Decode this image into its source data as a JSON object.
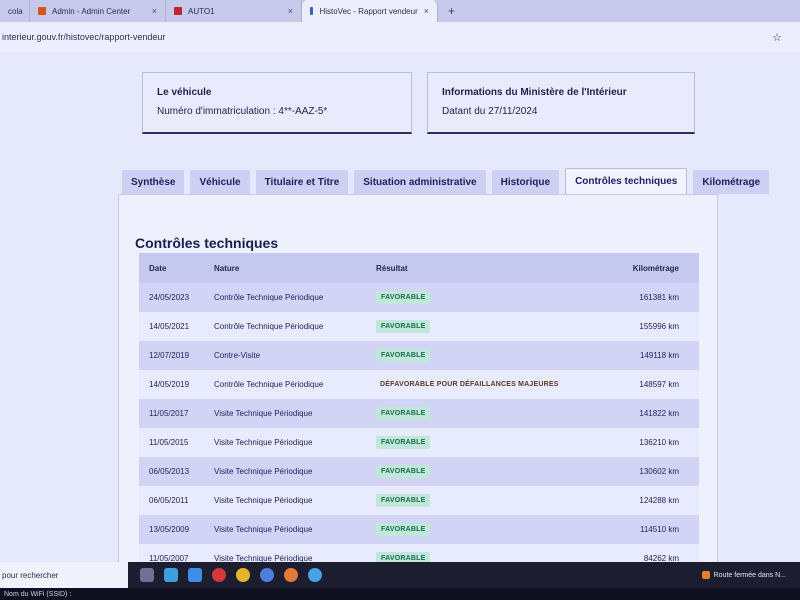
{
  "browser": {
    "tabs": [
      {
        "label": "cola",
        "favicon_color": "#5a6cc2"
      },
      {
        "label": "Admin - Admin Center",
        "favicon_color": "#d9531e"
      },
      {
        "label": "AUTO1",
        "favicon_color": "#c0262d"
      },
      {
        "label": "HistoVec - Rapport vendeur",
        "favicon_color": "#3b5fc9"
      }
    ],
    "new_tab_label": "+",
    "close_label": "×",
    "url": "interieur.gouv.fr/histovec/rapport-vendeur",
    "star_label": "☆"
  },
  "vehicle": {
    "title": "Le véhicule",
    "value": "Numéro d'immatriculation : 4**-AAZ-5*"
  },
  "ministry": {
    "title": "Informations du Ministère de l'Intérieur",
    "value": "Datant du 27/11/2024"
  },
  "tabs": [
    {
      "label": "Synthèse"
    },
    {
      "label": "Véhicule"
    },
    {
      "label": "Titulaire et Titre"
    },
    {
      "label": "Situation administrative"
    },
    {
      "label": "Historique"
    },
    {
      "label": "Contrôles techniques",
      "active": true
    },
    {
      "label": "Kilométrage"
    }
  ],
  "controls": {
    "title": "Contrôles techniques",
    "headers": {
      "date": "Date",
      "nature": "Nature",
      "result": "Résultat",
      "km": "Kilométrage"
    },
    "rows": [
      {
        "date": "24/05/2023",
        "nature": "Contrôle Technique Périodique",
        "result": "FAVORABLE",
        "km": "161381 km"
      },
      {
        "date": "14/05/2021",
        "nature": "Contrôle Technique Périodique",
        "result": "FAVORABLE",
        "km": "155996 km"
      },
      {
        "date": "12/07/2019",
        "nature": "Contre-Visite",
        "result": "FAVORABLE",
        "km": "149118 km"
      },
      {
        "date": "14/05/2019",
        "nature": "Contrôle Technique Périodique",
        "result": "DÉFAVORABLE POUR DÉFAILLANCES MAJEURES",
        "km": "148597 km"
      },
      {
        "date": "11/05/2017",
        "nature": "Visite Technique Périodique",
        "result": "FAVORABLE",
        "km": "141822 km"
      },
      {
        "date": "11/05/2015",
        "nature": "Visite Technique Périodique",
        "result": "FAVORABLE",
        "km": "136210 km"
      },
      {
        "date": "06/05/2013",
        "nature": "Visite Technique Périodique",
        "result": "FAVORABLE",
        "km": "130602 km"
      },
      {
        "date": "06/05/2011",
        "nature": "Visite Technique Périodique",
        "result": "FAVORABLE",
        "km": "124288 km"
      },
      {
        "date": "13/05/2009",
        "nature": "Visite Technique Périodique",
        "result": "FAVORABLE",
        "km": "114510 km"
      },
      {
        "date": "11/05/2007",
        "nature": "Visite Technique Périodique",
        "result": "FAVORABLE",
        "km": "84262 km"
      }
    ]
  },
  "taskbar": {
    "search_label": "pour rechercher",
    "notification": "Route fermée dans N...",
    "wifi_label": "Nom du WiFi (SSID) :"
  },
  "colors": {
    "favorable_bg": "#bfe8d8",
    "favorable_text": "#1b6a52"
  }
}
